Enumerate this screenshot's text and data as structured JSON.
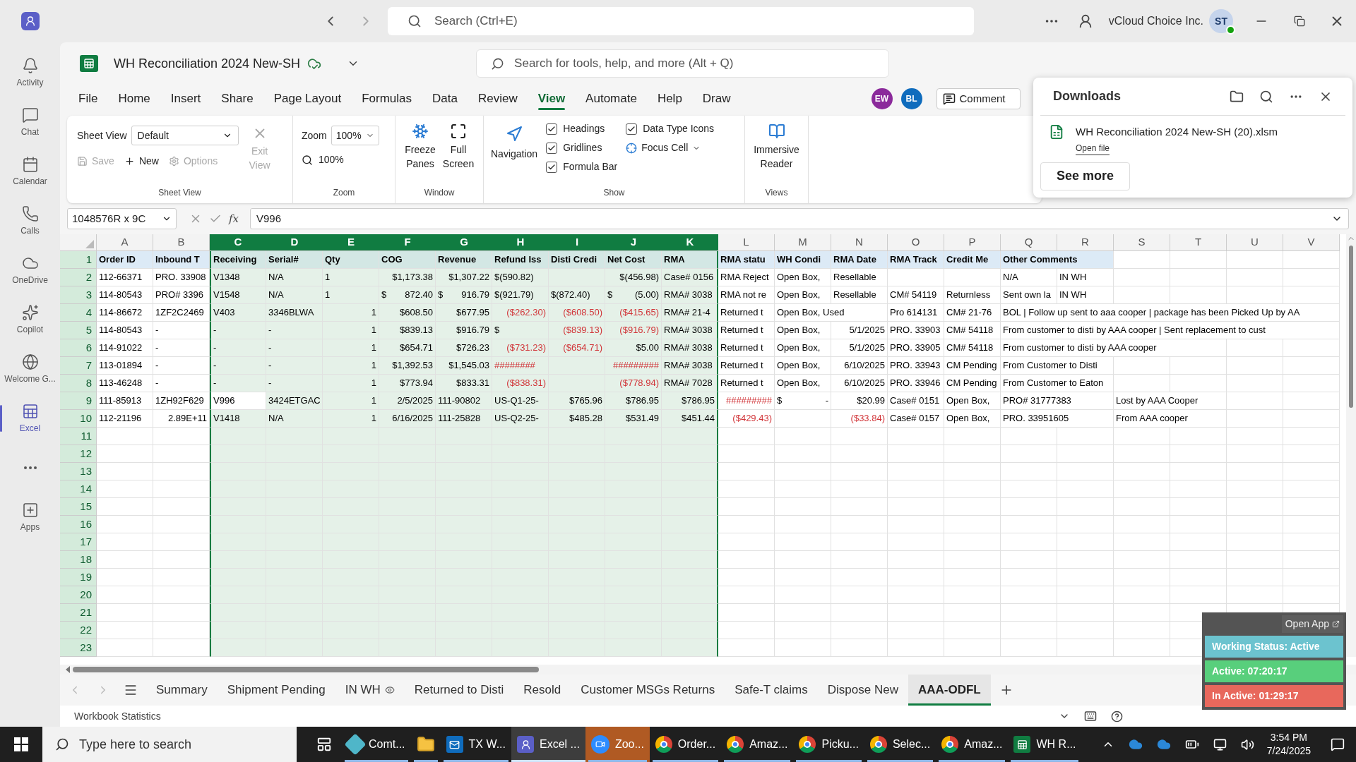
{
  "teams": {
    "search_placeholder": "Search (Ctrl+E)",
    "org": "vCloud Choice Inc.",
    "avatar": "ST",
    "rail": [
      {
        "kind": "activity",
        "label": "Activity",
        "selected": false
      },
      {
        "kind": "chat",
        "label": "Chat",
        "selected": false
      },
      {
        "kind": "calendar",
        "label": "Calendar",
        "selected": false
      },
      {
        "kind": "calls",
        "label": "Calls",
        "selected": false
      },
      {
        "kind": "onedrive",
        "label": "OneDrive",
        "selected": false
      },
      {
        "kind": "copilot",
        "label": "Copilot",
        "selected": false
      },
      {
        "kind": "welcome",
        "label": "Welcome G...",
        "selected": false
      },
      {
        "kind": "excel",
        "label": "Excel",
        "selected": true
      },
      {
        "kind": "more",
        "selected": false
      },
      {
        "kind": "apps",
        "label": "Apps",
        "selected": false
      }
    ]
  },
  "workbook": {
    "title": "WH Reconciliation 2024 New-SH",
    "search_placeholder": "Search for tools, help, and more (Alt + Q)",
    "menu": [
      {
        "label": "File",
        "selected": false
      },
      {
        "label": "Home",
        "selected": false
      },
      {
        "label": "Insert",
        "selected": false
      },
      {
        "label": "Share",
        "selected": false
      },
      {
        "label": "Page Layout",
        "selected": false
      },
      {
        "label": "Formulas",
        "selected": false
      },
      {
        "label": "Data",
        "selected": false
      },
      {
        "label": "Review",
        "selected": false
      },
      {
        "label": "View",
        "selected": true
      },
      {
        "label": "Automate",
        "selected": false
      },
      {
        "label": "Help",
        "selected": false
      },
      {
        "label": "Draw",
        "selected": false
      }
    ],
    "collaborators": [
      {
        "initials": "EW",
        "color": "#8b2a9b"
      },
      {
        "initials": "BL",
        "color": "#0f6cbd"
      }
    ],
    "comments_button": "Comment"
  },
  "ribbon": {
    "sheet_view": {
      "label": "Sheet View",
      "select": "Default",
      "actions": [
        {
          "label": "Save",
          "disabled": true
        },
        {
          "label": "New",
          "disabled": false
        },
        {
          "label": "Options",
          "disabled": true
        }
      ],
      "exit": {
        "label": "Exit View",
        "disabled": true
      },
      "group": "Sheet View"
    },
    "zoom": {
      "label": "Zoom",
      "select": "100%",
      "reset": "100%",
      "group": "Zoom"
    },
    "window": {
      "freeze": "Freeze Panes",
      "full": "Full Screen",
      "group": "Window"
    },
    "show": {
      "navigation": "Navigation",
      "checkboxes": [
        {
          "label": "Headings",
          "checked": true
        },
        {
          "label": "Gridlines",
          "checked": true
        },
        {
          "label": "Formula Bar",
          "checked": true
        },
        {
          "label": "Data Type Icons",
          "checked": true
        }
      ],
      "focus_cell": "Focus Cell",
      "group": "Show"
    },
    "views": {
      "button": "Immersive Reader",
      "group": "Views"
    }
  },
  "formula_bar": {
    "name_box": "1048576R x 9C",
    "function_label": "fx",
    "value": "V996"
  },
  "grid": {
    "columns": [
      {
        "label": "A",
        "selected": false
      },
      {
        "label": "B",
        "selected": false
      },
      {
        "label": "C",
        "selected": true
      },
      {
        "label": "D",
        "selected": true
      },
      {
        "label": "E",
        "selected": true
      },
      {
        "label": "F",
        "selected": true
      },
      {
        "label": "G",
        "selected": true
      },
      {
        "label": "H",
        "selected": true
      },
      {
        "label": "I",
        "selected": true
      },
      {
        "label": "J",
        "selected": true
      },
      {
        "label": "K",
        "selected": true
      },
      {
        "label": "L",
        "selected": false
      },
      {
        "label": "M",
        "selected": false
      },
      {
        "label": "N",
        "selected": false
      },
      {
        "label": "O",
        "selected": false
      },
      {
        "label": "P",
        "selected": false
      },
      {
        "label": "Q",
        "selected": false
      },
      {
        "label": "R",
        "selected": false
      },
      {
        "label": "S",
        "selected": false
      },
      {
        "label": "T",
        "selected": false
      },
      {
        "label": "U",
        "selected": false
      },
      {
        "label": "V",
        "selected": false
      }
    ],
    "rows": [
      {
        "number": "1",
        "kind": "header",
        "cells": [
          "Order ID",
          "Inbound T",
          "Receiving",
          "Serial#",
          "Qty",
          "COG",
          "Revenue",
          "Refund Iss",
          "Disti Credi",
          "Net Cost",
          "RMA",
          "RMA statu",
          "WH Condi",
          "RMA Date",
          "RMA Track",
          "Credit Me",
          "Other Comments"
        ]
      },
      {
        "number": "2",
        "kind": "data",
        "cells": [
          "112-66371",
          "PRO. 33908",
          "V1348",
          "N/A",
          "1",
          {
            "kind": "num",
            "text": "$1,173.38"
          },
          {
            "kind": "num",
            "text": "$1,307.22"
          },
          "$(590.82)",
          null,
          {
            "kind": "num",
            "text": "$(456.98)"
          },
          "Case# 0156",
          "RMA Reject",
          "Open Box,",
          "Resellable",
          null,
          null,
          "N/A",
          "IN WH"
        ]
      },
      {
        "number": "3",
        "kind": "data",
        "cells": [
          "114-80543",
          "PRO# 3396",
          "V1548",
          "N/A",
          "1",
          {
            "kind": "acct",
            "symbol": "$",
            "text": "872.40"
          },
          {
            "kind": "acct",
            "symbol": "$",
            "text": "916.79"
          },
          "$(921.79)",
          "$(872.40)",
          {
            "kind": "acct",
            "symbol": "$",
            "text": "(5.00)"
          },
          "RMA# 3038",
          "RMA not re",
          "Open Box,",
          "Resellable",
          "CM# 54119",
          "Returnless",
          "Sent own la",
          "IN WH"
        ]
      },
      {
        "number": "4",
        "kind": "data",
        "cells": [
          "114-86672",
          "1ZF2C2469",
          "V403",
          "3346BLWA",
          {
            "kind": "num",
            "text": "1"
          },
          {
            "kind": "num",
            "text": "$608.50"
          },
          {
            "kind": "num",
            "text": "$677.95"
          },
          {
            "kind": "num",
            "text": "($262.30)",
            "negative": true
          },
          {
            "kind": "num",
            "text": "($608.50)",
            "negative": true
          },
          {
            "kind": "num",
            "text": "($415.65)",
            "negative": true
          },
          "RMA# 21-4",
          "Returned t",
          "Open Box, Used",
          null,
          "Pro 614131",
          "CM# 21-76",
          "BOL | Follow up sent to aaa cooper | package has been Picked Up by AA"
        ]
      },
      {
        "number": "5",
        "kind": "data",
        "cells": [
          "114-80543",
          "-",
          "-",
          "-",
          {
            "kind": "num",
            "text": "1"
          },
          {
            "kind": "num",
            "text": "$839.13"
          },
          {
            "kind": "num",
            "text": "$916.79"
          },
          "$",
          {
            "kind": "num",
            "text": "($839.13)",
            "negative": true
          },
          {
            "kind": "num",
            "text": "($916.79)",
            "negative": true
          },
          "RMA# 3038",
          "Returned t",
          "Open Box,",
          {
            "kind": "num",
            "text": "5/1/2025"
          },
          "PRO. 33903",
          "CM# 54118",
          "From customer to disti by AAA cooper | Sent replacement to cust"
        ]
      },
      {
        "number": "6",
        "kind": "data",
        "cells": [
          "114-91022",
          "-",
          "-",
          "-",
          {
            "kind": "num",
            "text": "1"
          },
          {
            "kind": "num",
            "text": "$654.71"
          },
          {
            "kind": "num",
            "text": "$726.23"
          },
          {
            "kind": "num",
            "text": "($731.23)",
            "negative": true
          },
          {
            "kind": "num",
            "text": "($654.71)",
            "negative": true
          },
          {
            "kind": "num",
            "text": "$5.00"
          },
          "RMA# 3038",
          "Returned t",
          "Open Box,",
          {
            "kind": "num",
            "text": "5/1/2025"
          },
          "PRO. 33905",
          "CM# 54118",
          "From customer to disti by AAA cooper"
        ]
      },
      {
        "number": "7",
        "kind": "data",
        "cells": [
          "113-01894",
          "-",
          "-",
          "-",
          {
            "kind": "num",
            "text": "1"
          },
          {
            "kind": "num",
            "text": "$1,392.53"
          },
          {
            "kind": "num",
            "text": "$1,545.03"
          },
          {
            "kind": "text",
            "text": "########",
            "negative": true
          },
          null,
          {
            "kind": "num",
            "text": "#########",
            "negative": true
          },
          "RMA# 3038",
          "Returned t",
          "Open Box,",
          {
            "kind": "num",
            "text": "6/10/2025"
          },
          "PRO. 33943",
          "CM Pending",
          "From Customer to Disti"
        ]
      },
      {
        "number": "8",
        "kind": "data",
        "cells": [
          "113-46248",
          "-",
          "-",
          "-",
          {
            "kind": "num",
            "text": "1"
          },
          {
            "kind": "num",
            "text": "$773.94"
          },
          {
            "kind": "num",
            "text": "$833.31"
          },
          {
            "kind": "num",
            "text": "($838.31)",
            "negative": true
          },
          null,
          {
            "kind": "num",
            "text": "($778.94)",
            "negative": true
          },
          "RMA# 7028",
          "Returned t",
          "Open Box,",
          {
            "kind": "num",
            "text": "6/10/2025"
          },
          "PRO. 33946",
          "CM Pending",
          "From Customer to Eaton"
        ]
      },
      {
        "number": "9",
        "kind": "data",
        "cells": [
          "111-85913",
          "1ZH92F629",
          {
            "kind": "text",
            "text": "V996",
            "selected": true
          },
          "3424ETGAC",
          {
            "kind": "num",
            "text": "1"
          },
          {
            "kind": "num",
            "text": "2/5/2025"
          },
          "111-90802",
          "US-Q1-25-",
          {
            "kind": "num",
            "text": "$765.96"
          },
          {
            "kind": "num",
            "text": "$786.95"
          },
          {
            "kind": "num",
            "text": "$786.95"
          },
          {
            "kind": "num",
            "text": "#########",
            "negative": true
          },
          {
            "kind": "acct",
            "symbol": "$",
            "text": "-"
          },
          {
            "kind": "num",
            "text": "$20.99"
          },
          "Case# 0151",
          "Open Box,",
          "PRO# 31777383",
          null,
          "Lost by AAA Cooper"
        ]
      },
      {
        "number": "10",
        "kind": "data",
        "cells": [
          "112-21196",
          {
            "kind": "num",
            "text": "2.89E+11"
          },
          "V1418",
          "N/A",
          {
            "kind": "num",
            "text": "1"
          },
          {
            "kind": "num",
            "text": "6/16/2025"
          },
          "111-25828",
          "US-Q2-25-",
          {
            "kind": "num",
            "text": "$485.28"
          },
          {
            "kind": "num",
            "text": "$531.49"
          },
          {
            "kind": "num",
            "text": "$451.44"
          },
          {
            "kind": "num",
            "text": "($429.43)",
            "negative": true
          },
          null,
          {
            "kind": "num",
            "text": "($33.84)",
            "negative": true
          },
          "Case# 0157",
          "Open Box,",
          "PRO. 33951605",
          null,
          "From AAA cooper"
        ]
      },
      {
        "number": "11",
        "kind": "data"
      },
      {
        "number": "12",
        "kind": "data"
      },
      {
        "number": "13",
        "kind": "data"
      },
      {
        "number": "14",
        "kind": "data"
      },
      {
        "number": "15",
        "kind": "data"
      },
      {
        "number": "16",
        "kind": "data"
      },
      {
        "number": "17",
        "kind": "data"
      },
      {
        "number": "18",
        "kind": "data"
      },
      {
        "number": "19",
        "kind": "data"
      },
      {
        "number": "20",
        "kind": "data"
      },
      {
        "number": "21",
        "kind": "data"
      },
      {
        "number": "22",
        "kind": "data"
      },
      {
        "number": "23",
        "kind": "data"
      }
    ]
  },
  "sheet_tabs": [
    {
      "label": "Summary",
      "selected": false,
      "view_icon": false
    },
    {
      "label": "Shipment Pending",
      "selected": false,
      "view_icon": false
    },
    {
      "label": "IN WH",
      "selected": false,
      "view_icon": true
    },
    {
      "label": "Returned to Disti",
      "selected": false,
      "view_icon": false
    },
    {
      "label": "Resold",
      "selected": false,
      "view_icon": false
    },
    {
      "label": "Customer MSGs Returns",
      "selected": false,
      "view_icon": false
    },
    {
      "label": "Safe-T claims",
      "selected": false,
      "view_icon": false
    },
    {
      "label": "Dispose New",
      "selected": false,
      "view_icon": false
    },
    {
      "label": "AAA-ODFL",
      "selected": true,
      "view_icon": false
    }
  ],
  "status_bar": {
    "label": "Workbook Statistics"
  },
  "downloads": {
    "title": "Downloads",
    "file": "WH Reconciliation 2024 New-SH (20).xlsm",
    "link": "Open file",
    "button": "See more"
  },
  "status_widget": {
    "open_app": "Open App",
    "rows": [
      {
        "label": "Working Status: Active",
        "color": "#6cc3cf"
      },
      {
        "label": "Active: 07:20:17",
        "color": "#58cf7c"
      },
      {
        "label": "In Active: 01:29:17",
        "color": "#e8685c"
      }
    ]
  },
  "taskbar": {
    "search_placeholder": "Type here to search",
    "apps": [
      {
        "kind": "copilot",
        "label": "Comt...",
        "selected": false,
        "attention": false
      },
      {
        "kind": "explorer",
        "selected": false,
        "attention": false
      },
      {
        "kind": "outlook",
        "label": "TX W...",
        "selected": false,
        "attention": false
      },
      {
        "kind": "teams",
        "label": "Excel ...",
        "selected": true,
        "attention": false
      },
      {
        "kind": "zoom",
        "label": "Zoo...",
        "selected": false,
        "attention": true
      },
      {
        "kind": "chrome",
        "label": "Order...",
        "selected": false,
        "attention": false
      },
      {
        "kind": "chrome",
        "label": "Amaz...",
        "selected": false,
        "attention": false
      },
      {
        "kind": "chrome",
        "label": "Picku...",
        "selected": false,
        "attention": false
      },
      {
        "kind": "chrome",
        "label": "Selec...",
        "selected": false,
        "attention": false
      },
      {
        "kind": "chrome",
        "label": "Amaz...",
        "selected": false,
        "attention": false
      },
      {
        "kind": "excel",
        "label": "WH R...",
        "selected": false,
        "attention": false
      }
    ],
    "time": "3:54 PM",
    "date": "7/24/2025"
  }
}
